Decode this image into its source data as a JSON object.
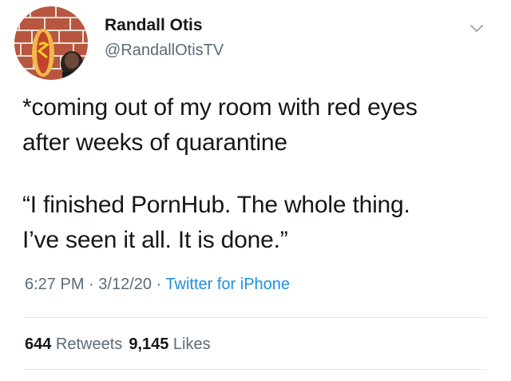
{
  "author": {
    "name": "Randall Otis",
    "handle": "@RandallOtisTV"
  },
  "avatar": {
    "icon": "profile-photo-hot-dog-brick-wall"
  },
  "menu": {
    "icon": "chevron-down-icon"
  },
  "tweet": {
    "paragraph1_line1": "*coming out of my room with red eyes",
    "paragraph1_line2": "after weeks of quarantine",
    "paragraph2_line1": "“I finished PornHub. The whole thing.",
    "paragraph2_line2": "I’ve seen it all. It is done.”"
  },
  "meta": {
    "time": "6:27 PM",
    "sep1": " · ",
    "date": "3/12/20",
    "sep2": " · ",
    "source": "Twitter for iPhone"
  },
  "stats": {
    "retweets_count": "644",
    "retweets_label": " Retweets",
    "likes_count": "9,145",
    "likes_label": " Likes"
  },
  "colors": {
    "text": "#14171a",
    "secondary": "#5b6b78",
    "link": "#1d8fe3",
    "divider": "#e1e6ea"
  }
}
